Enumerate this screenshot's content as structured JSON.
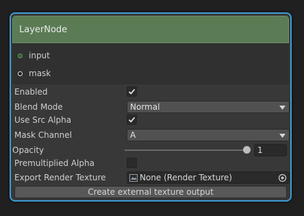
{
  "node": {
    "title": "LayerNode",
    "accent_color": "#3f9fd8",
    "header_color": "#5a7b53"
  },
  "ports": [
    {
      "label": "input",
      "icon": "port-connected-icon"
    },
    {
      "label": "mask",
      "icon": "port-empty-icon"
    }
  ],
  "fields": {
    "enabled": {
      "label": "Enabled",
      "checked": true
    },
    "blend_mode": {
      "label": "Blend Mode",
      "value": "Normal"
    },
    "use_src_alpha": {
      "label": "Use Src Alpha",
      "checked": true
    },
    "mask_channel": {
      "label": "Mask Channel",
      "value": "A"
    },
    "opacity": {
      "label": "Opacity",
      "value": "1",
      "level": 1.0
    },
    "premultiplied_alpha": {
      "label": "Premultiplied Alpha",
      "checked": false
    },
    "export_render_texture": {
      "label": "Export Render Texture",
      "value": "None (Render Texture)"
    }
  },
  "actions": {
    "create_output_label": "Create external texture output"
  }
}
